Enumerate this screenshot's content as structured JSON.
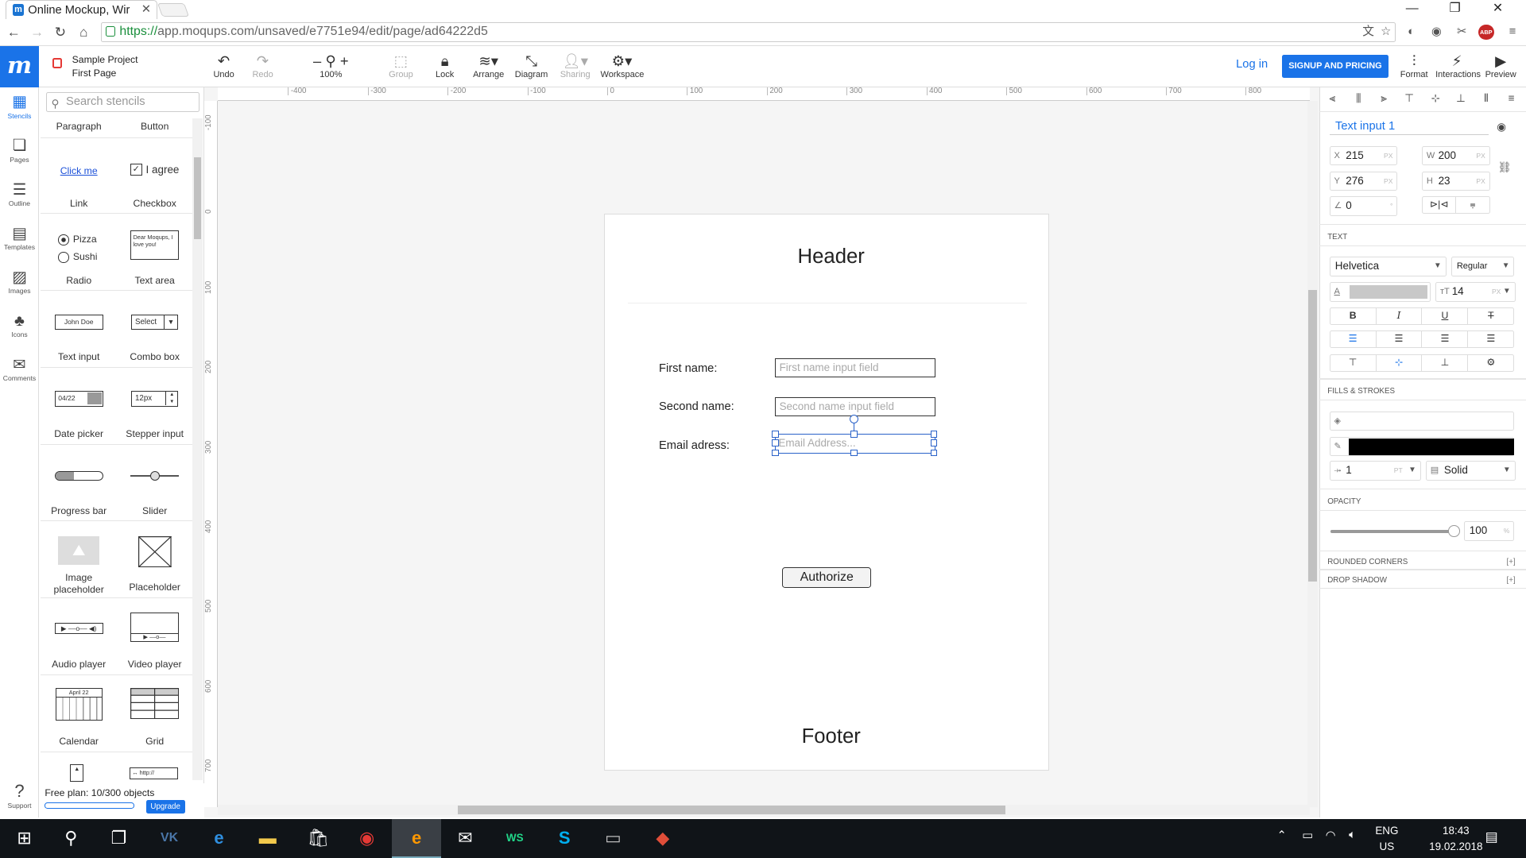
{
  "browser": {
    "tab_title": "Online Mockup, Wir",
    "url_secure": "https://",
    "url_rest": "app.moqups.com/unsaved/e7751e94/edit/page/ad64222d5",
    "ext_abp": "ABP"
  },
  "app": {
    "logo": "m",
    "project_name": "Sample Project",
    "page_name": "First Page",
    "zoom": "100%",
    "login": "Log in",
    "signup": "SIGNUP AND PRICING",
    "toolbar": {
      "undo": "Undo",
      "redo": "Redo",
      "group": "Group",
      "lock": "Lock",
      "arrange": "Arrange",
      "diagram": "Diagram",
      "sharing": "Sharing",
      "workspace": "Workspace",
      "format": "Format",
      "interactions": "Interactions",
      "preview": "Preview"
    }
  },
  "rail": {
    "stencils": "Stencils",
    "pages": "Pages",
    "outline": "Outline",
    "templates": "Templates",
    "images": "Images",
    "icons": "Icons",
    "comments": "Comments",
    "support": "Support"
  },
  "stencils": {
    "search_placeholder": "Search stencils",
    "header_left": "Paragraph",
    "header_right": "Button",
    "items": {
      "link": "Link",
      "link_preview": "Click me",
      "checkbox": "Checkbox",
      "checkbox_preview": "I agree",
      "radio": "Radio",
      "radio_opt1": "Pizza",
      "radio_opt2": "Sushi",
      "textarea": "Text area",
      "textarea_preview": "Dear Moqups, I love you!",
      "textinput": "Text input",
      "textinput_preview": "John Doe",
      "combobox": "Combo box",
      "combobox_preview": "Select",
      "datepicker": "Date picker",
      "datepicker_preview": "04/22",
      "stepper": "Stepper input",
      "stepper_preview": "12px",
      "progress": "Progress bar",
      "slider": "Slider",
      "imageph": "Image placeholder",
      "placeholder": "Placeholder",
      "audio": "Audio player",
      "video": "Video player",
      "calendar": "Calendar",
      "calendar_preview": "April 22",
      "grid": "Grid",
      "browser_preview": "http://"
    },
    "plan": "Free plan: 10/300 objects",
    "upgrade": "Upgrade"
  },
  "rulers": {
    "top": [
      "-400",
      "-300",
      "-200",
      "-100",
      "0",
      "100",
      "200",
      "300",
      "400",
      "500",
      "600",
      "700",
      "800"
    ],
    "left": [
      "-100",
      "0",
      "100",
      "200",
      "300",
      "400",
      "500",
      "600",
      "700"
    ]
  },
  "canvas": {
    "header": "Header",
    "first_label": "First name:",
    "first_placeholder": "First name input field",
    "second_label": "Second name:",
    "second_placeholder": "Second name input field",
    "email_label": "Email adress:",
    "email_placeholder": "Email Address...",
    "button": "Authorize",
    "footer": "Footer"
  },
  "props": {
    "element_name": "Text input 1",
    "x": "215",
    "y": "276",
    "w": "200",
    "h": "23",
    "angle": "0",
    "unit": "PX",
    "text_section": "TEXT",
    "font": "Helvetica",
    "weight": "Regular",
    "size": "14",
    "fills_section": "FILLS & STROKES",
    "stroke_width": "1",
    "stroke_unit": "PT",
    "stroke_style": "Solid",
    "stroke_color": "#000000",
    "text_color": "#c8c8c8",
    "opacity_section": "OPACITY",
    "opacity": "100",
    "opacity_unit": "%",
    "rounded": "ROUNDED CORNERS",
    "shadow": "DROP SHADOW",
    "expand": "[+]"
  },
  "taskbar": {
    "lang1": "ENG",
    "lang2": "US",
    "time": "18:43",
    "date": "19.02.2018"
  },
  "colors": {
    "accent": "#1a73e8",
    "selection": "#2a62c9",
    "taskbar": "#101418"
  }
}
